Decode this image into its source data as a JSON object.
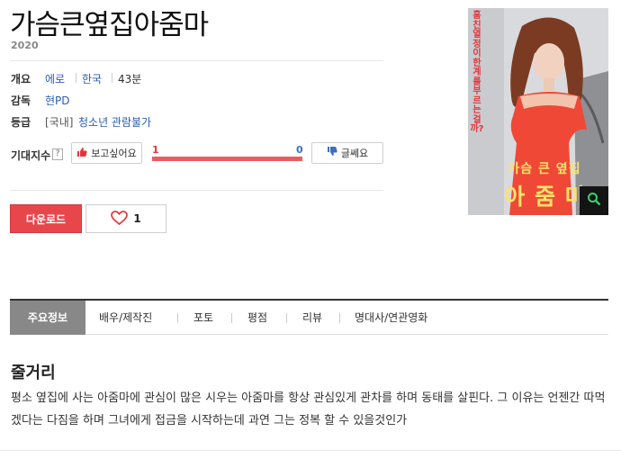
{
  "movie": {
    "title": "가슴큰옆집아줌마",
    "year": "2020"
  },
  "info": {
    "overview_label": "개요",
    "genre": "에로",
    "country": "한국",
    "runtime": "43분",
    "director_label": "감독",
    "director": "현PD",
    "rating_label": "등급",
    "rating_prefix": "[국내]",
    "rating": "청소년 관람불가"
  },
  "expectation": {
    "label": "기대지수",
    "help": "?",
    "want_label": "보고싶어요",
    "meh_label": "글쎄요",
    "want_count": "1",
    "meh_count": "0",
    "want_fraction": 1.0
  },
  "actions": {
    "download_label": "다운로드",
    "like_count": "1"
  },
  "poster": {
    "vertical_text": "훔친 열정이 한계를 부르는걸까?",
    "title_line1": "가슴 큰 옆집",
    "title_line2": "아 줌 마"
  },
  "tabs": [
    {
      "label": "주요정보"
    },
    {
      "label": "배우/제작진"
    },
    {
      "label": "포토"
    },
    {
      "label": "평점"
    },
    {
      "label": "리뷰"
    },
    {
      "label": "명대사/연관영화"
    }
  ],
  "synopsis": {
    "heading": "줄거리",
    "text": "평소 옆집에 사는 아줌마에 관심이 많은 시우는 아줌마를 항상 관심있게 관차를 하며 동태를 살핀다. 그 이유는 언젠간 따먹겠다는 다짐을 하며 그녀에게 접금을 시작하는데 과연 그는 정복 할 수 있을것인가"
  },
  "colors": {
    "accent_red": "#e7474b",
    "link_blue": "#2a5db0",
    "tab_active": "#888888"
  }
}
